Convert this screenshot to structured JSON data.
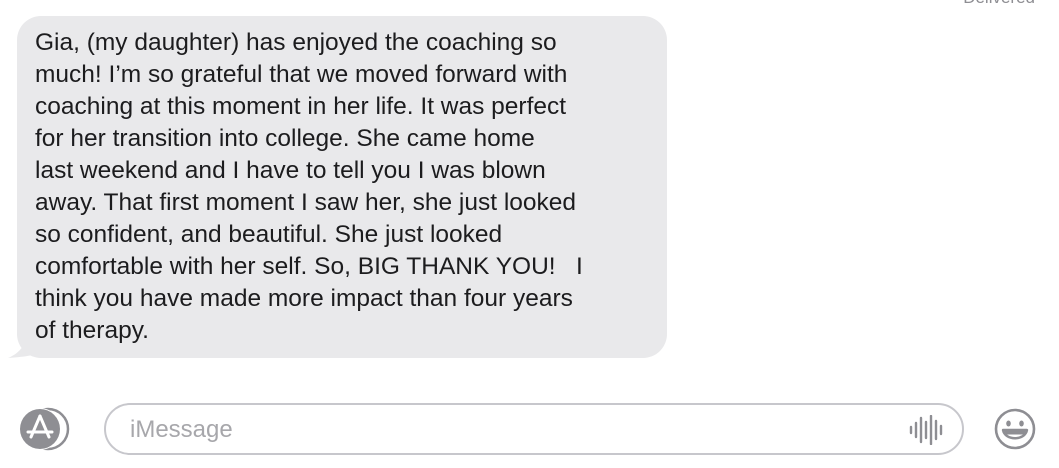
{
  "status": {
    "delivered_label": "Delivered"
  },
  "message": {
    "lines": [
      "Gia, (my daughter) has enjoyed the coaching so",
      "much! I’m so grateful that we moved forward with",
      "coaching at this moment in her life. It was perfect",
      "for her transition into college. She came home",
      "last weekend and I have to tell you I was blown",
      "away. That first moment I saw her, she just looked",
      "so confident, and beautiful. She just looked",
      "comfortable with her self. So, BIG THANK YOU!   I",
      "think you have made more impact than four years",
      "of therapy."
    ]
  },
  "composer": {
    "placeholder": "iMessage",
    "value": "",
    "apps_icon": "app-store-icon",
    "audio_icon": "waveform-icon",
    "emoji_icon": "emoji-icon"
  },
  "colors": {
    "bubble_received": "#e9e9eb",
    "text": "#1c1c1e",
    "icon_gray": "#8e8e93",
    "field_border": "#c7c7cc"
  }
}
